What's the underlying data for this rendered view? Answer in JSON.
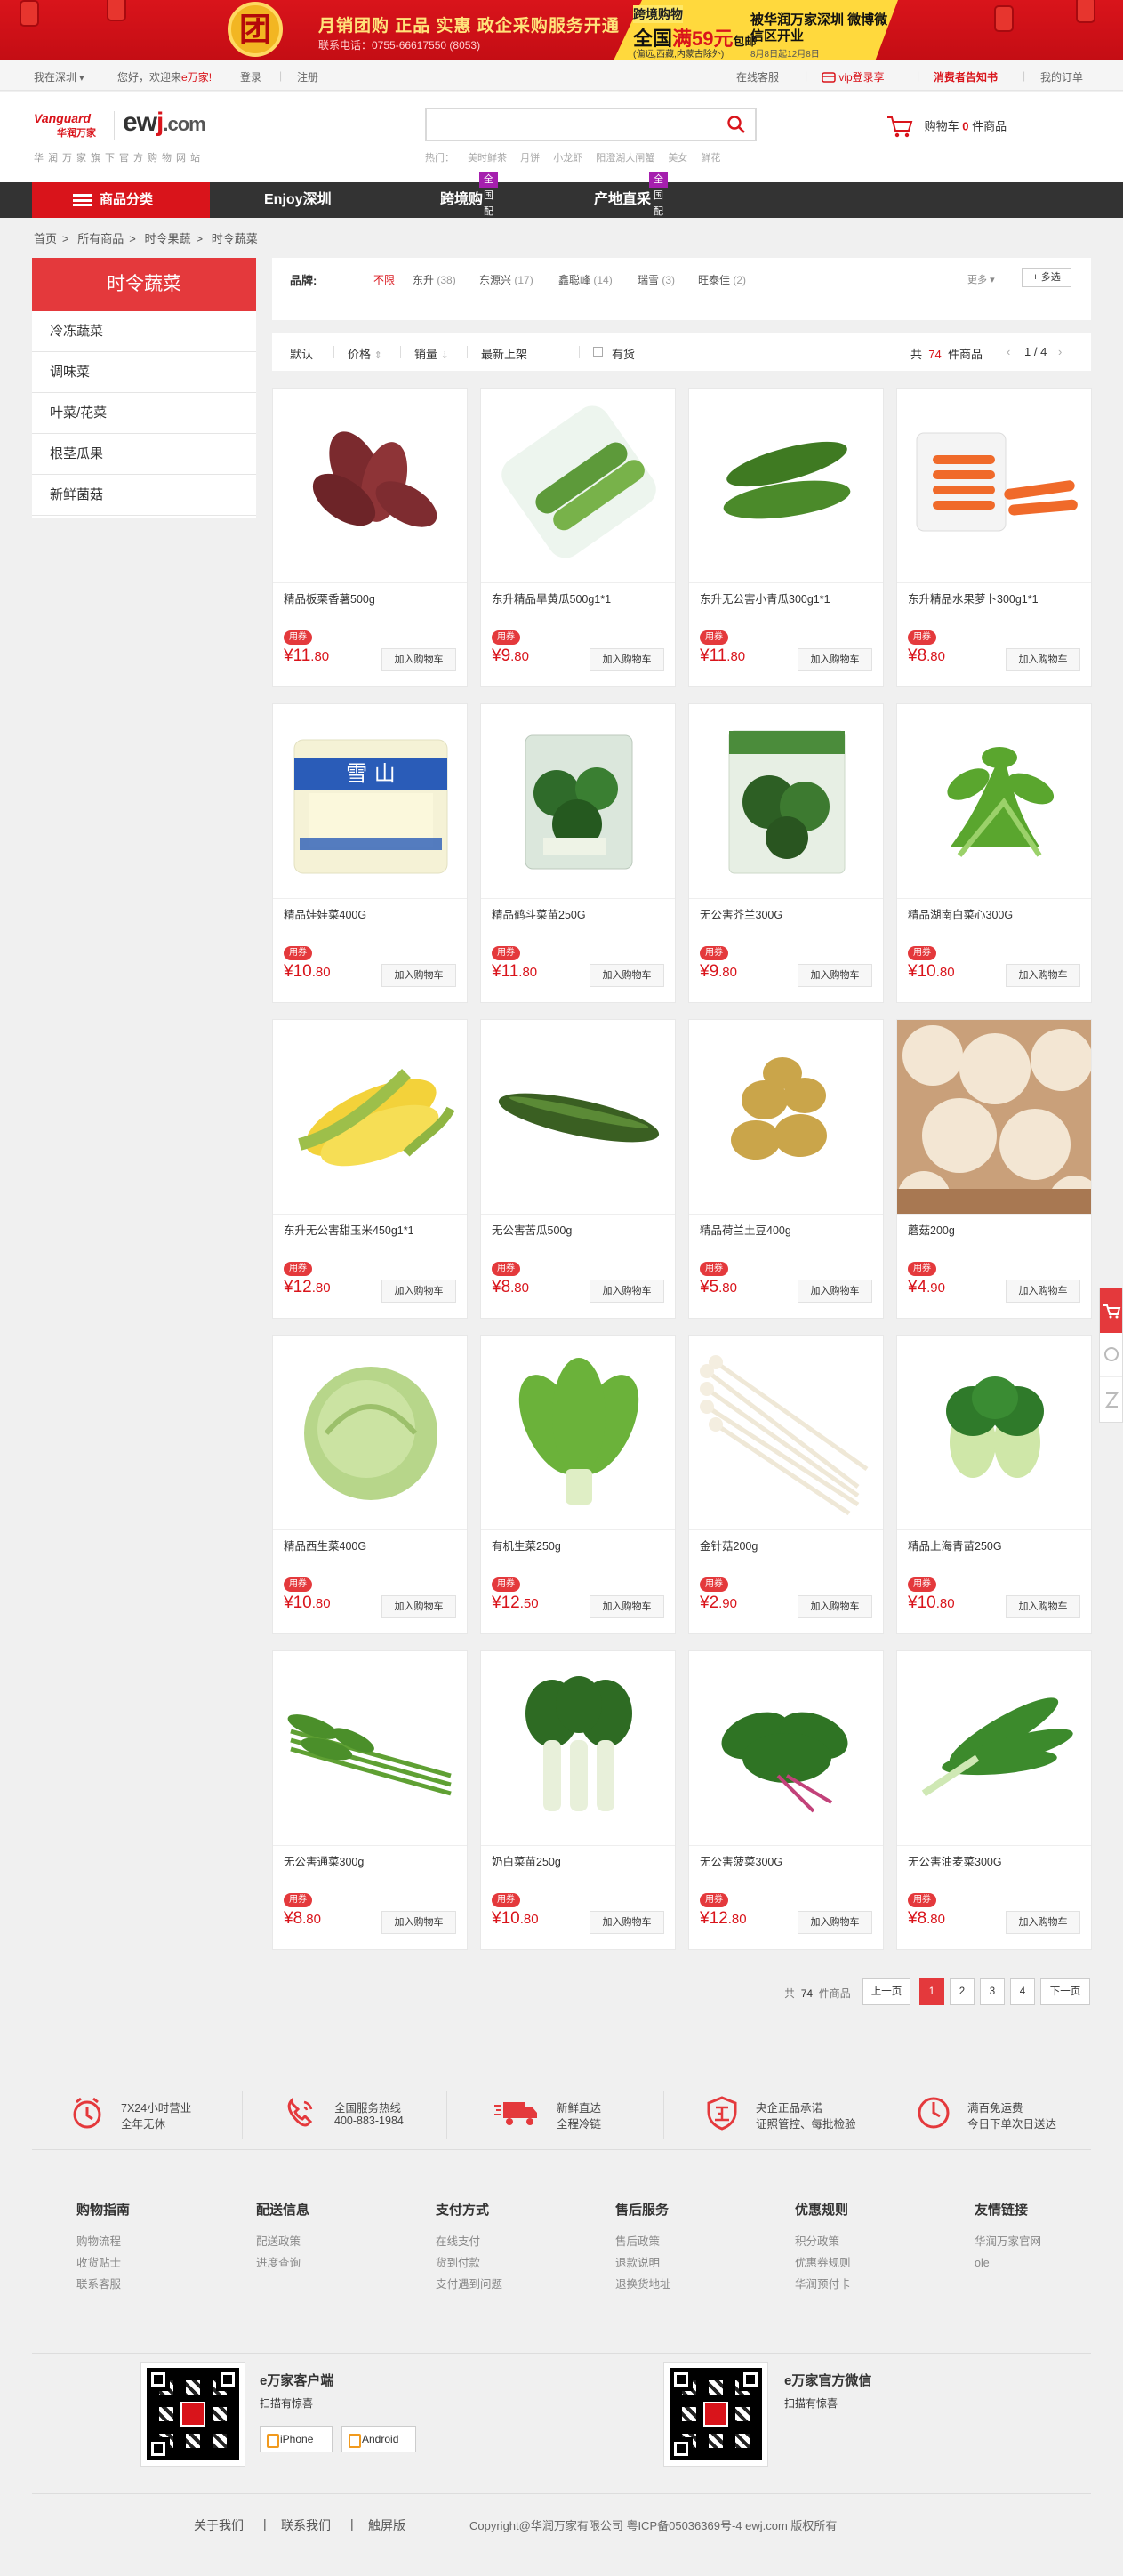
{
  "banner": {
    "badge": "团",
    "line1": "月销团购 正品 实惠  政企采购服务开通",
    "line2": "联系电话：0755-66617550 (8053)",
    "y1": "跨境购物",
    "y2_a": "全国",
    "y2_b": "满59元",
    "y2_c": "包邮",
    "y3": "(偏远,西藏,内蒙古除外)",
    "y4": "被华润万家深圳 微博微信区开业",
    "y5": "8月8日起12月8日"
  },
  "topbar": {
    "location": "我在深圳",
    "location_arrow": "▾",
    "welcome": "您好，欢迎来",
    "brand": "e万家!",
    "login": "登录",
    "register": "注册",
    "service": "在线客服",
    "vip": "vip登录享",
    "notice": "消费者告知书",
    "orders": "我的订单"
  },
  "header": {
    "logo_v": "Vanguard",
    "logo_cn": "华润万家",
    "logo_e": "ew",
    "logo_j": "j",
    "logo_com": ".com",
    "logo_sub": "华润万家旗下官方购物网站",
    "search_placeholder": "",
    "hot_label": "热门：",
    "hot": [
      "美时鲜茶",
      "月饼",
      "小龙虾",
      "阳澄湖大闸蟹",
      "美女",
      "鲜花"
    ],
    "cart_label": "购物车",
    "cart_count": "0",
    "cart_unit": "件商品"
  },
  "nav": {
    "category": "商品分类",
    "items": [
      {
        "label": "Enjoy深圳",
        "tag": ""
      },
      {
        "label": "跨境购",
        "tag": "全国配"
      },
      {
        "label": "产地直采",
        "tag": "全国配"
      }
    ]
  },
  "breadcrumb": [
    "首页",
    ">",
    "所有商品",
    ">",
    "时令果蔬",
    ">",
    "时令蔬菜"
  ],
  "sidebar": {
    "title": "时令蔬菜",
    "items": [
      "冷冻蔬菜",
      "调味菜",
      "叶菜/花菜",
      "根茎瓜果",
      "新鲜菌菇"
    ]
  },
  "brands": {
    "label": "品牌:",
    "unlimited": "不限",
    "items": [
      {
        "name": "东升",
        "count": "(38)"
      },
      {
        "name": "东源兴",
        "count": "(17)"
      },
      {
        "name": "鑫聪峰",
        "count": "(14)"
      },
      {
        "name": "瑞雪",
        "count": "(3)"
      },
      {
        "name": "旺泰佳",
        "count": "(2)"
      }
    ],
    "more": "更多",
    "multi": "+ 多选"
  },
  "sort": {
    "default": "默认",
    "price": "价格",
    "sales": "销量",
    "newest": "最新上架",
    "in_stock": "有货",
    "total_a": "共",
    "total": "74",
    "total_b": "件商品",
    "page": "1 / 4"
  },
  "products": [
    {
      "name": "精品板栗香薯500g",
      "coupon": "用券",
      "yuan": "¥11",
      "cent": ".80",
      "img": "sweet-potato"
    },
    {
      "name": "东升精品旱黄瓜500g1*1",
      "coupon": "用券",
      "yuan": "¥9",
      "cent": ".80",
      "img": "cucumber-pack"
    },
    {
      "name": "东升无公害小青瓜300g1*1",
      "coupon": "用券",
      "yuan": "¥11",
      "cent": ".80",
      "img": "cucumber"
    },
    {
      "name": "东升精品水果萝卜300g1*1",
      "coupon": "用券",
      "yuan": "¥8",
      "cent": ".80",
      "img": "carrot"
    },
    {
      "name": "精品娃娃菜400G",
      "coupon": "用券",
      "yuan": "¥10",
      "cent": ".80",
      "img": "baby-cabbage"
    },
    {
      "name": "精品鹤斗菜苗250G",
      "coupon": "用券",
      "yuan": "¥11",
      "cent": ".80",
      "img": "greens-bag"
    },
    {
      "name": "无公害芥兰300G",
      "coupon": "用券",
      "yuan": "¥9",
      "cent": ".80",
      "img": "kale-bag"
    },
    {
      "name": "精品湖南白菜心300G",
      "coupon": "用券",
      "yuan": "¥10",
      "cent": ".80",
      "img": "choy"
    },
    {
      "name": "东升无公害甜玉米450g1*1",
      "coupon": "用券",
      "yuan": "¥12",
      "cent": ".80",
      "img": "corn"
    },
    {
      "name": "无公害苦瓜500g",
      "coupon": "用券",
      "yuan": "¥8",
      "cent": ".80",
      "img": "bitter-melon"
    },
    {
      "name": "精品荷兰土豆400g",
      "coupon": "用券",
      "yuan": "¥5",
      "cent": ".80",
      "img": "potato"
    },
    {
      "name": "蘑菇200g",
      "coupon": "用券",
      "yuan": "¥4",
      "cent": ".90",
      "img": "mushroom"
    },
    {
      "name": "精品西生菜400G",
      "coupon": "用券",
      "yuan": "¥10",
      "cent": ".80",
      "img": "lettuce"
    },
    {
      "name": "有机生菜250g",
      "coupon": "用券",
      "yuan": "¥12",
      "cent": ".50",
      "img": "leaf-lettuce"
    },
    {
      "name": "金针菇200g",
      "coupon": "用券",
      "yuan": "¥2",
      "cent": ".90",
      "img": "enoki"
    },
    {
      "name": "精品上海青苗250G",
      "coupon": "用券",
      "yuan": "¥10",
      "cent": ".80",
      "img": "bok-choy"
    },
    {
      "name": "无公害通菜300g",
      "coupon": "用券",
      "yuan": "¥8",
      "cent": ".80",
      "img": "water-spinach"
    },
    {
      "name": "奶白菜苗250g",
      "coupon": "用券",
      "yuan": "¥10",
      "cent": ".80",
      "img": "milk-cabbage"
    },
    {
      "name": "无公害菠菜300G",
      "coupon": "用券",
      "yuan": "¥12",
      "cent": ".80",
      "img": "spinach"
    },
    {
      "name": "无公害油麦菜300G",
      "coupon": "用券",
      "yuan": "¥8",
      "cent": ".80",
      "img": "lettuce-stem"
    }
  ],
  "add_cart": "加入购物车",
  "pager": {
    "total_a": "共",
    "total": "74",
    "total_b": "件商品",
    "prev": "上一页",
    "pages": [
      "1",
      "2",
      "3",
      "4"
    ],
    "next": "下一页"
  },
  "services": [
    {
      "a": "7X24小时营业",
      "b": "全年无休"
    },
    {
      "a": "全国服务热线",
      "b": "400-883-1984"
    },
    {
      "a": "新鲜直达",
      "b": "全程冷链"
    },
    {
      "a": "央企正品承诺",
      "b": "证照管控、每批检验"
    },
    {
      "a": "满百免运费",
      "b": "今日下单次日送达"
    }
  ],
  "footer_cols": [
    {
      "title": "购物指南",
      "links": [
        "购物流程",
        "收货贴士",
        "联系客服"
      ]
    },
    {
      "title": "配送信息",
      "links": [
        "配送政策",
        "进度查询"
      ]
    },
    {
      "title": "支付方式",
      "links": [
        "在线支付",
        "货到付款",
        "支付遇到问题"
      ]
    },
    {
      "title": "售后服务",
      "links": [
        "售后政策",
        "退款说明",
        "退换货地址"
      ]
    },
    {
      "title": "优惠规则",
      "links": [
        "积分政策",
        "优惠券规则",
        "华润预付卡"
      ]
    },
    {
      "title": "友情链接",
      "links": [
        "华润万家官网",
        "ole"
      ]
    }
  ],
  "apps": {
    "client_title": "e万家客户端",
    "client_sub": "扫描有惊喜",
    "iphone": "iPhone",
    "android": "Android",
    "wechat_title": "e万家官方微信",
    "wechat_sub": "扫描有惊喜"
  },
  "bottom": {
    "about": "关于我们",
    "contact": "联系我们",
    "screen": "触屏版",
    "sep": "|",
    "copyright": "Copyright@华润万家有限公司  粤ICP备05036369号-4   ewj.com 版权所有"
  },
  "colors": {
    "brand_red": "#d9141b",
    "nav_dark": "#333333",
    "tag_purple": "#a51fae"
  }
}
